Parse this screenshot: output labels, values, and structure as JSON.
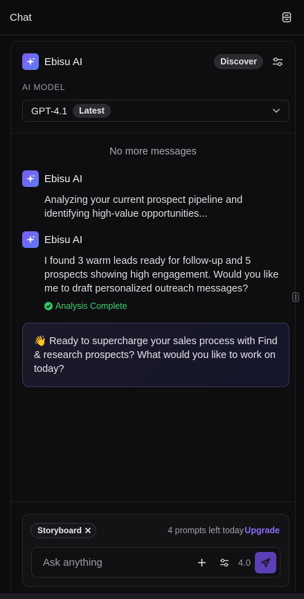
{
  "topbar": {
    "title": "Chat",
    "toggle_icon": "panel-toggle-icon"
  },
  "agent": {
    "name": "Ebisu AI",
    "avatar_icon": "sparkle-icon",
    "discover_label": "Discover",
    "settings_icon": "sliders-icon"
  },
  "model": {
    "label": "AI MODEL",
    "selected": "GPT-4.1",
    "badge": "Latest"
  },
  "conversation": {
    "no_more": "No more messages",
    "messages": [
      {
        "author": "Ebisu AI",
        "text": "Analyzing your current prospect pipeline and identifying high-value opportunities..."
      },
      {
        "author": "Ebisu AI",
        "text": "I found 3 warm leads ready for follow-up and 5 prospects showing high engagement. Would you like me to draft personalized outreach messages?",
        "status": "Analysis Complete"
      }
    ],
    "welcome": "👋 Ready to supercharge your sales process with Find & research prospects? What would you like to work on today?"
  },
  "composer": {
    "chip_label": "Storyboard",
    "prompts_left": "4 prompts left today",
    "upgrade_label": "Upgrade",
    "placeholder": "Ask anything",
    "temperature": "4.0"
  },
  "colors": {
    "accent": "#8b6cf7",
    "send_button": "#5b3fb4",
    "success": "#34c563",
    "background": "#0c0c0e"
  }
}
